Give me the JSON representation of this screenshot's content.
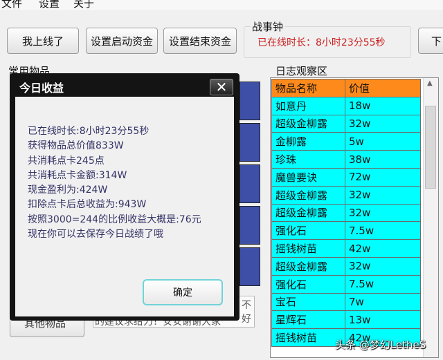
{
  "menu": {
    "items": [
      "文件",
      "设置",
      "关于"
    ]
  },
  "toolbar": {
    "online_button": "我上线了",
    "start_funds_button": "设置启动资金",
    "end_funds_button": "设置结束资金",
    "next_button_partial": "下"
  },
  "clock": {
    "title": "战事钟",
    "online_text": "已在线时长：8小时23分55秒"
  },
  "common_items": {
    "title": "常用物品",
    "bottom_button": "其他物品",
    "notice_line1": "的建议求给力！安安谢谢大家",
    "notice_right1": "不",
    "notice_right2": "好"
  },
  "log": {
    "title": "日志观察区",
    "columns": [
      "物品名称",
      "价值"
    ],
    "rows": [
      [
        "如意丹",
        "18w"
      ],
      [
        "超级金柳露",
        "32w"
      ],
      [
        "金柳露",
        "5w"
      ],
      [
        "珍珠",
        "38w"
      ],
      [
        "魔兽要诀",
        "72w"
      ],
      [
        "超级金柳露",
        "32w"
      ],
      [
        "超级金柳露",
        "32w"
      ],
      [
        "强化石",
        "7.5w"
      ],
      [
        "摇钱树苗",
        "42w"
      ],
      [
        "超级金柳露",
        "32w"
      ],
      [
        "强化石",
        "7.5w"
      ],
      [
        "宝石",
        "7w"
      ],
      [
        "星辉石",
        "13w"
      ],
      [
        "摇钱树苗",
        "42w"
      ]
    ]
  },
  "dialog": {
    "title": "今日收益",
    "close_label": "✕",
    "lines": [
      "已在线时长:8小时23分55秒",
      "获得物品总价值833W",
      "共消耗点卡245点",
      "共消耗点卡金额:314W",
      "现金盈利为:424W",
      "扣除点卡后总收益为:943W",
      "按照3000=244的比例收益大概是:76元",
      "现在你可以去保存今日战绩了哦"
    ],
    "ok_button": "确定"
  },
  "watermark": "头条 @梦幻LetheS",
  "colors": {
    "log_header_bg": "#ff8a1c",
    "log_row_bg": "#00ffff",
    "clock_text": "#cc1f1f",
    "dialog_frame": "#141414"
  }
}
